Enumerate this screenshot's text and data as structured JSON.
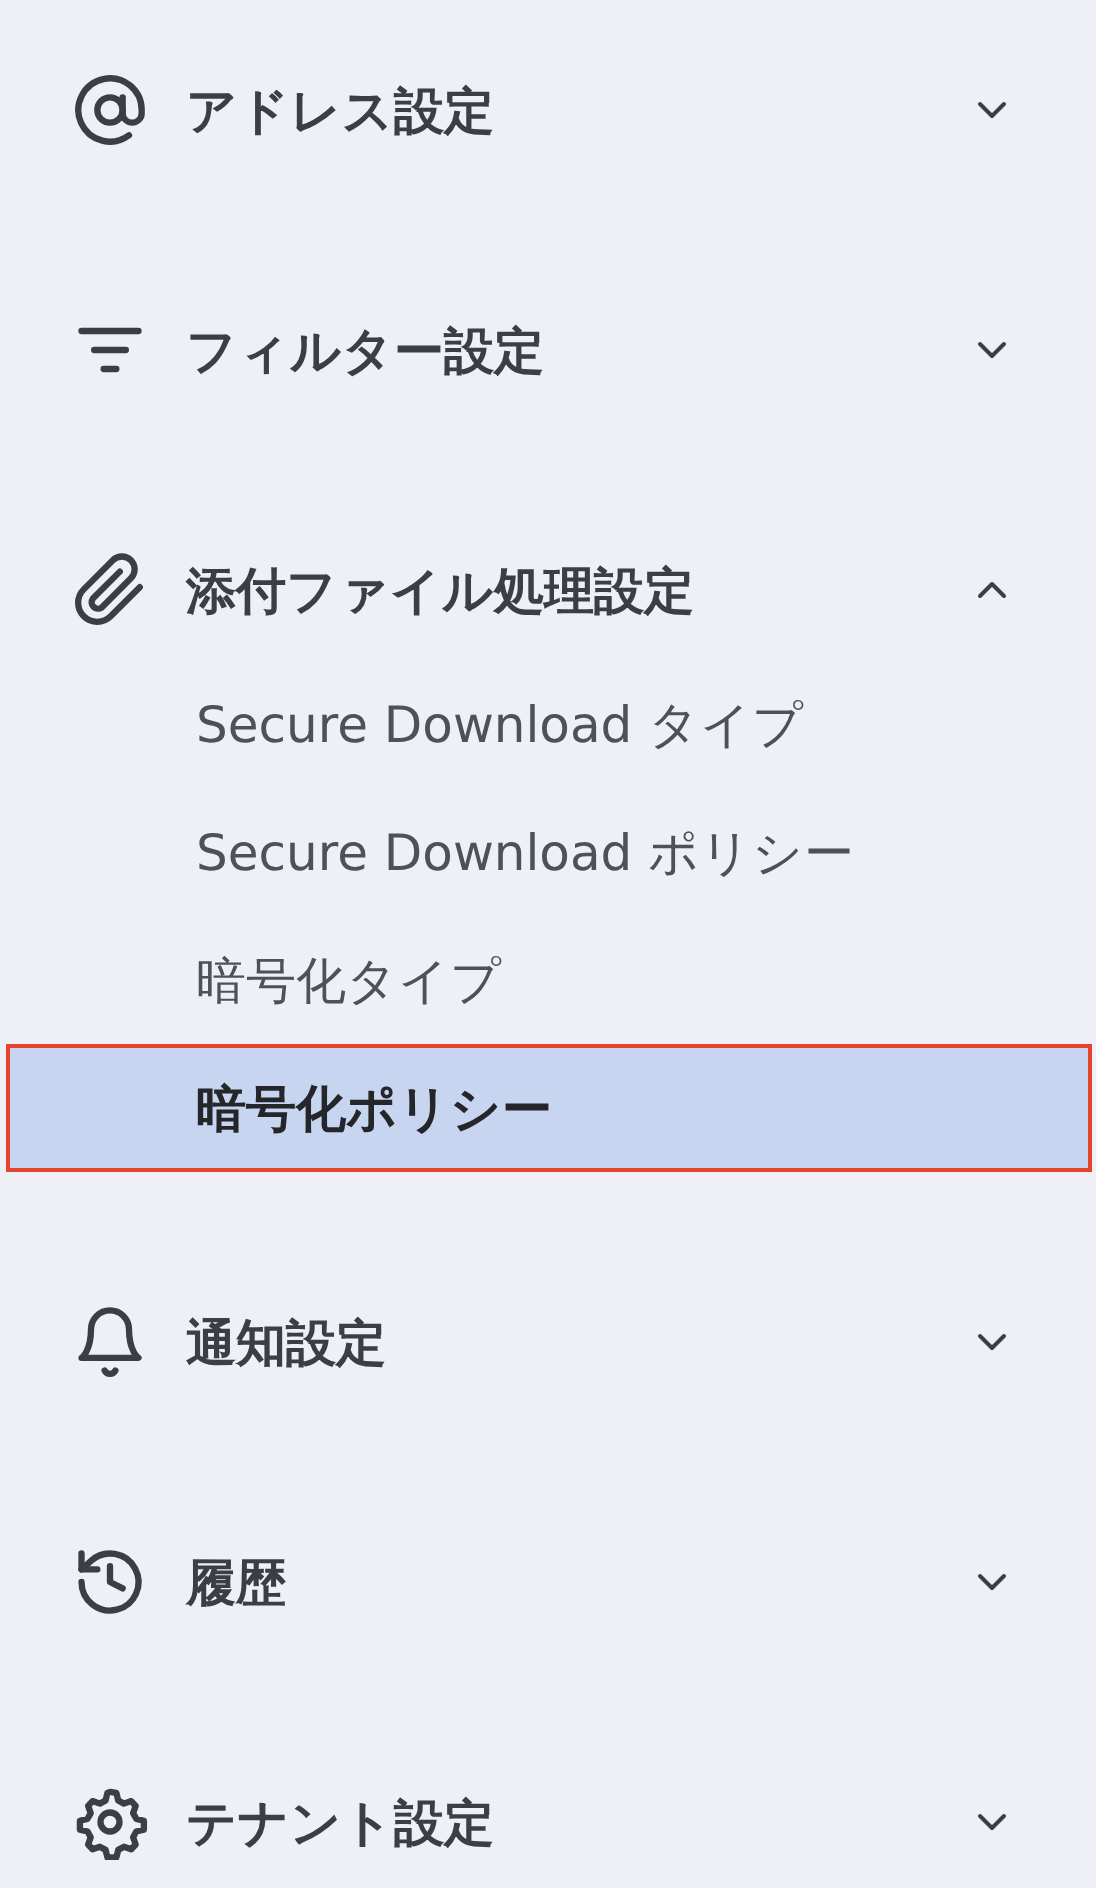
{
  "sections": [
    {
      "label": "アドレス設定",
      "expanded": false
    },
    {
      "label": "フィルター設定",
      "expanded": false
    },
    {
      "label": "添付ファイル処理設定",
      "expanded": true,
      "children": [
        {
          "label": "Secure Download タイプ",
          "selected": false
        },
        {
          "label": "Secure Download ポリシー",
          "selected": false
        },
        {
          "label": "暗号化タイプ",
          "selected": false
        },
        {
          "label": "暗号化ポリシー",
          "selected": true
        }
      ]
    },
    {
      "label": "通知設定",
      "expanded": false
    },
    {
      "label": "履歴",
      "expanded": false
    },
    {
      "label": "テナント設定",
      "expanded": false
    }
  ]
}
